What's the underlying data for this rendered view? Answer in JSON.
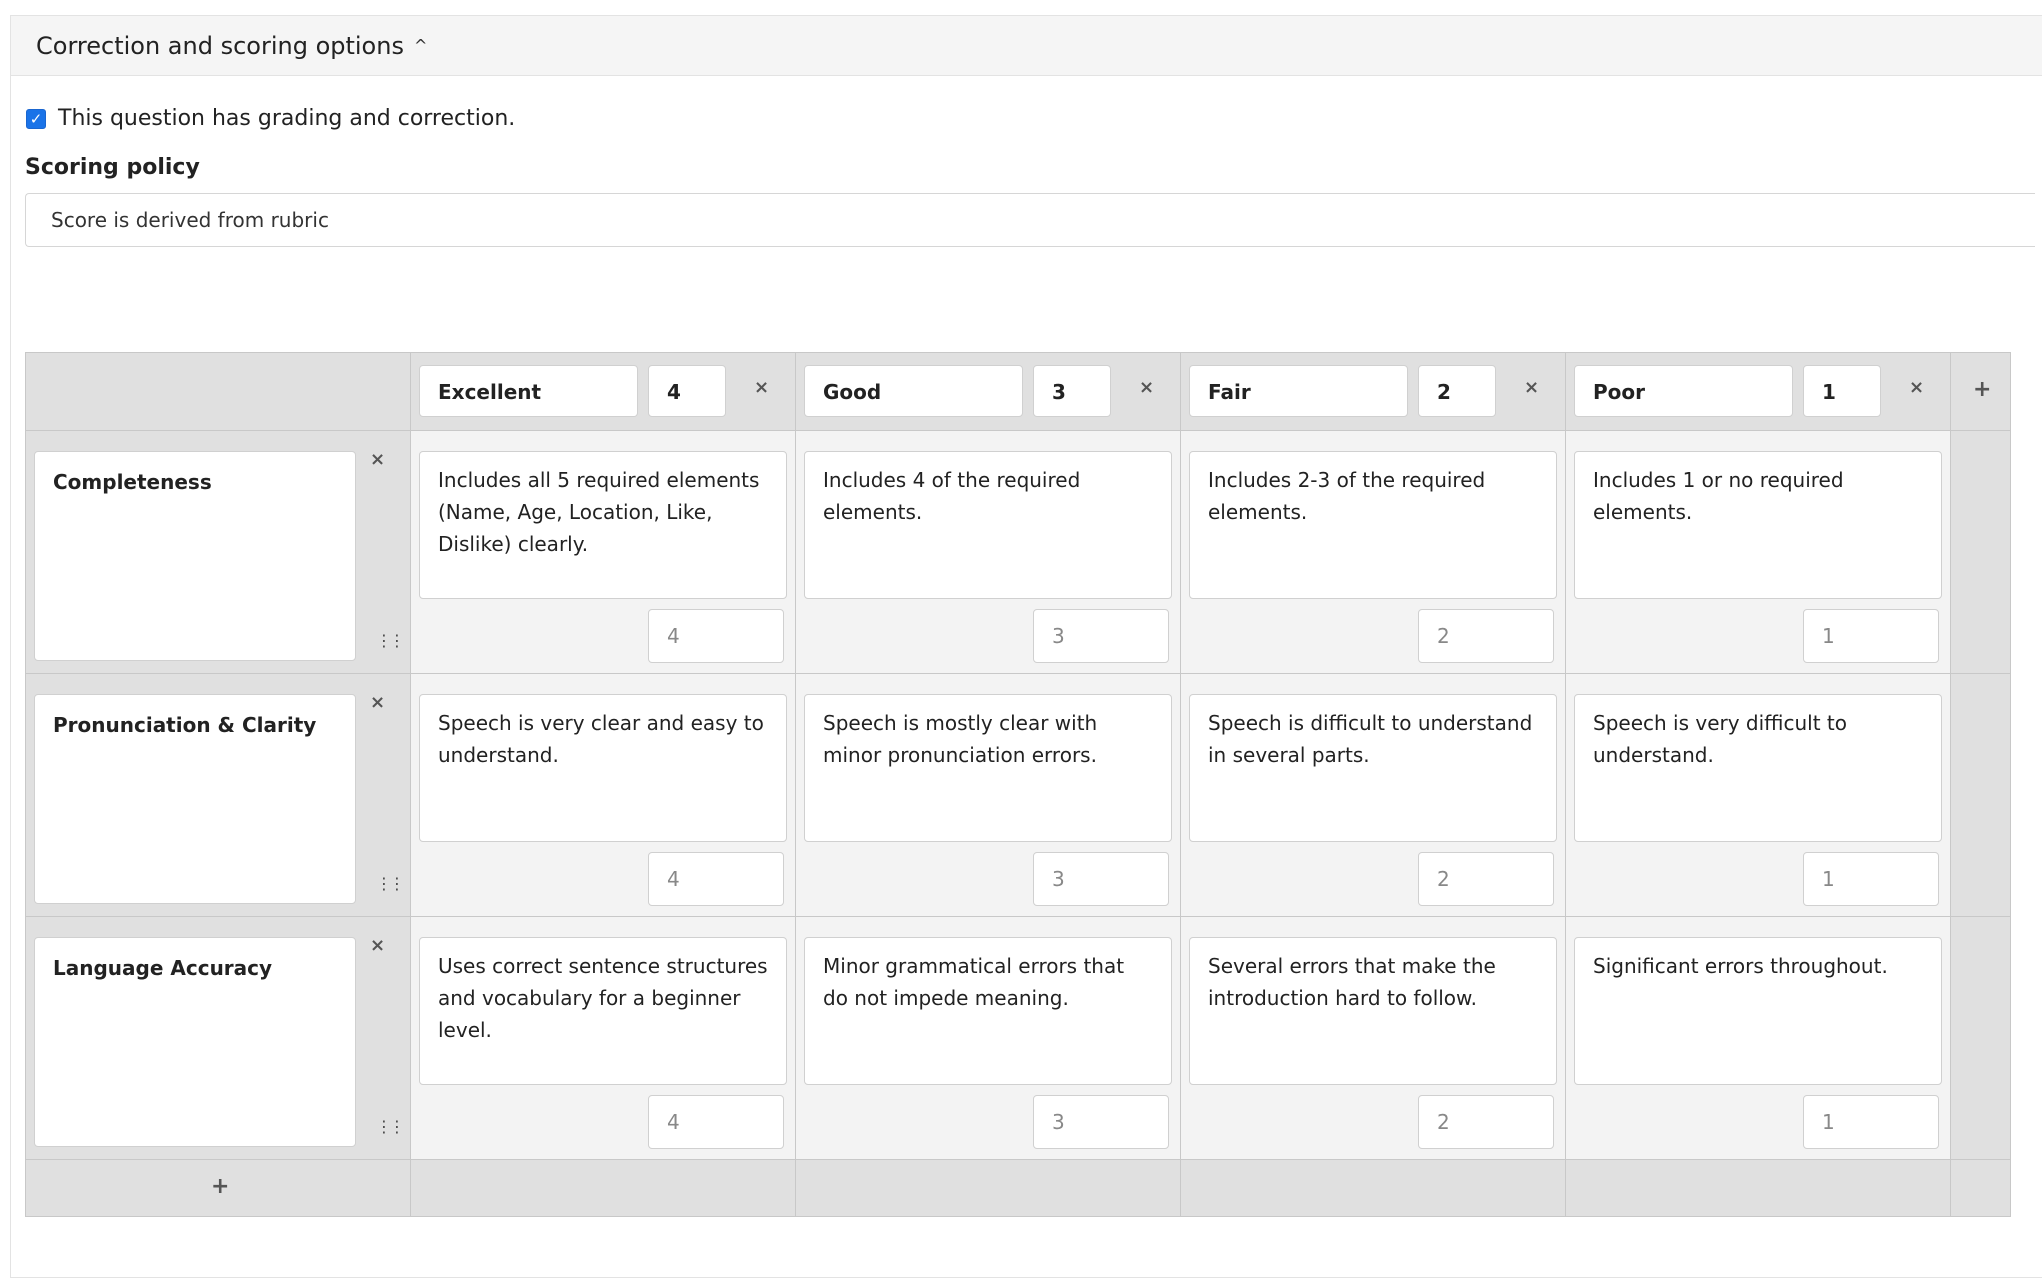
{
  "panel": {
    "title": "Correction and scoring options",
    "chevron": "^"
  },
  "grading": {
    "checked": true,
    "label": "This question has grading and correction."
  },
  "scoring": {
    "label": "Scoring policy",
    "value": "Score is derived from rubric"
  },
  "rubric": {
    "levels": [
      {
        "name": "Excellent",
        "points": "4"
      },
      {
        "name": "Good",
        "points": "3"
      },
      {
        "name": "Fair",
        "points": "2"
      },
      {
        "name": "Poor",
        "points": "1"
      }
    ],
    "criteria": [
      {
        "name": "Completeness",
        "cells": [
          {
            "desc": "Includes all 5 required elements (Name, Age, Location, Like, Dislike) clearly.",
            "points": "4"
          },
          {
            "desc": "Includes 4 of the required elements.",
            "points": "3"
          },
          {
            "desc": "Includes 2-3 of the required elements.",
            "points": "2"
          },
          {
            "desc": "Includes 1 or no required elements.",
            "points": "1"
          }
        ]
      },
      {
        "name": "Pronunciation & Clarity",
        "cells": [
          {
            "desc": "Speech is very clear and easy to understand.",
            "points": "4"
          },
          {
            "desc": "Speech is mostly clear with minor pronunciation errors.",
            "points": "3"
          },
          {
            "desc": "Speech is difficult to understand in several parts.",
            "points": "2"
          },
          {
            "desc": "Speech is very difficult to understand.",
            "points": "1"
          }
        ]
      },
      {
        "name": "Language Accuracy",
        "cells": [
          {
            "desc": "Uses correct sentence structures and vocabulary for a beginner level.",
            "points": "4"
          },
          {
            "desc": "Minor grammatical errors that do not impede meaning.",
            "points": "3"
          },
          {
            "desc": "Several errors that make the introduction hard to follow.",
            "points": "2"
          },
          {
            "desc": "Significant errors throughout.",
            "points": "1"
          }
        ]
      }
    ],
    "icons": {
      "remove": "×",
      "add": "+",
      "drag": "⋮⋮"
    }
  }
}
